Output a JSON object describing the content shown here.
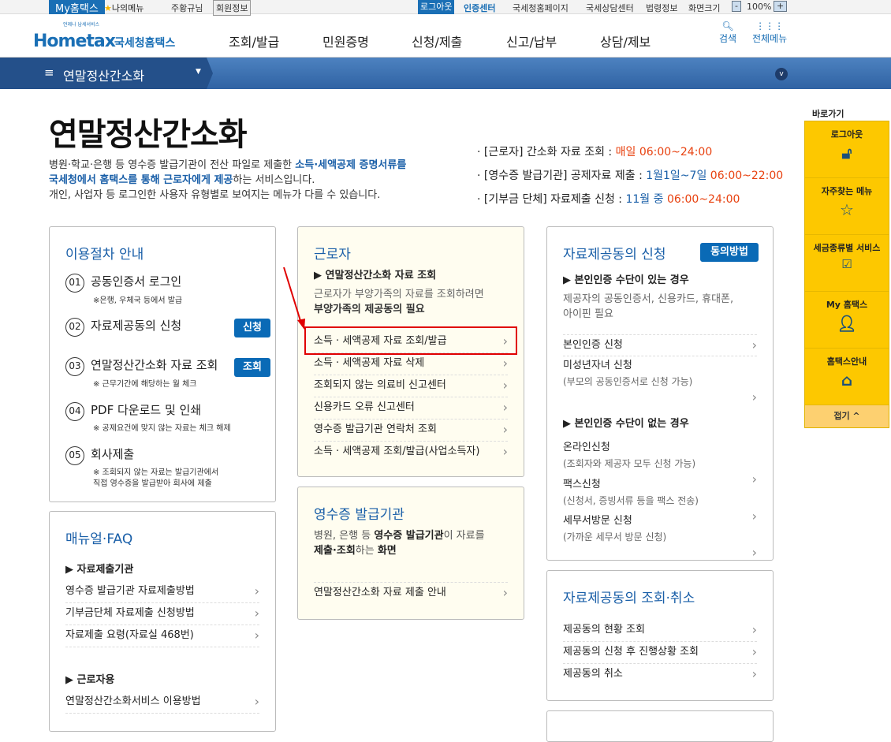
{
  "topbar": {
    "my_hometax": "My홈택스",
    "my_menu": "나의메뉴",
    "user": "주황규님",
    "member_info": "회원정보",
    "logout": "로그아웃",
    "cert_center": "인증센터",
    "links": [
      "국세청홈페이지",
      "국세상담센터",
      "법령정보",
      "화면크기"
    ],
    "zoom": "100%",
    "zoom_minus": "-",
    "zoom_plus": "+"
  },
  "header": {
    "logo": "Hometax",
    "logo_sub": "국세청홈택스",
    "logo_tag": "언제나 납세서비스",
    "nav": [
      "조회/발급",
      "민원증명",
      "신청/제출",
      "신고/납부",
      "상담/제보"
    ],
    "search": "검색",
    "all_menu": "전체메뉴"
  },
  "navbar": {
    "current": "연말정산간소화"
  },
  "page": {
    "title": "연말정산간소화",
    "intro1a": "병원·학교·은행 등 영수증 발급기관이 전산 파일로 제출한 ",
    "intro1b": "소득·세액공제 증명서류를",
    "intro2a": "국세청에서 홈택스를 통해 근로자에게 제공",
    "intro2b": "하는 서비스입니다.",
    "intro3": "개인, 사업자 등 로그인한 사용자 유형별로 보여지는 메뉴가 다를 수 있습니다.",
    "schedule": [
      {
        "label": "· [근로자] 간소화 자료 조회 : ",
        "period": "매일 ",
        "time": "06:00~24:00"
      },
      {
        "label": "· [영수증 발급기관] 공제자료 제출 : ",
        "period": "1월1일~7일 ",
        "time": "06:00~22:00"
      },
      {
        "label": "· [기부금 단체] 자료제출 신청 : ",
        "period": "11월 중 ",
        "time": "06:00~24:00"
      }
    ]
  },
  "procedure": {
    "title": "이용절차 안내",
    "steps": [
      {
        "num": "01",
        "label": "공동인증서 로그인",
        "note": "※은행, 우체국 등에서 발급"
      },
      {
        "num": "02",
        "label": "자료제공동의 신청",
        "button": "신청"
      },
      {
        "num": "03",
        "label": "연말정산간소화 자료 조회",
        "note": "※ 근무기간에 해당하는 월 체크",
        "button": "조회"
      },
      {
        "num": "04",
        "label": "PDF 다운로드 및 인쇄",
        "note": "※ 공제요건에 맞지 않는 자료는 체크 해제"
      },
      {
        "num": "05",
        "label": "회사제출",
        "note": "※ 조회되지 않는 자료는 발급기관에서",
        "note2": "직접 영수증을 발급받아 회사에 제출"
      }
    ]
  },
  "manual": {
    "title": "매뉴얼·FAQ",
    "sec1": "▶ 자료제출기관",
    "links1": [
      "영수증 발급기관 자료제출방법",
      "기부금단체 자료제출 신청방법",
      "자료제출 요령(자료실 468번)"
    ],
    "sec2": "▶ 근로자용",
    "links2": [
      "연말정산간소화서비스 이용방법"
    ]
  },
  "worker": {
    "title": "근로자",
    "sec": "▶ 연말정산간소화 자료 조회",
    "desc1": "근로자가 부양가족의 자료를 조회하려면",
    "desc2": "부양가족의 제공동의 필요",
    "links": [
      "소득 · 세액공제 자료 조회/발급",
      "소득 · 세액공제 자료 삭제",
      "조회되지 않는 의료비 신고센터",
      "신용카드 오류 신고센터",
      "영수증 발급기관 연락처 조회",
      "소득 · 세액공제 조회/발급(사업소득자)"
    ]
  },
  "issuer": {
    "title": "영수증 발급기관",
    "desc1a": "병원, 은행 등 ",
    "desc1b": "영수증 발급기관",
    "desc1c": "이 자료를",
    "desc2a": "제출·조회",
    "desc2b": "하는 ",
    "desc2c": "화면",
    "links": [
      "연말정산간소화 자료 제출 안내"
    ]
  },
  "consent": {
    "title": "자료제공동의 신청",
    "button": "동의방법",
    "sec1": "▶ 본인인증 수단이 있는 경우",
    "desc1": "제공자의 공동인증서, 신용카드, 휴대폰,",
    "desc2": "아이핀 필요",
    "links1": [
      {
        "label": "본인인증 신청"
      },
      {
        "label": "미성년자녀 신청",
        "sub": "(부모의 공동인증서로 신청 가능)"
      }
    ],
    "sec2": "▶ 본인인증 수단이 없는 경우",
    "links2": [
      {
        "label": "온라인신청",
        "sub": "(조회자와 제공자 모두 신청 가능)"
      },
      {
        "label": "팩스신청",
        "sub": "(신청서, 증빙서류 등을 팩스 전송)"
      },
      {
        "label": "세무서방문 신청",
        "sub": "(가까운 세무서 방문 신청)"
      }
    ]
  },
  "consent_query": {
    "title": "자료제공동의 조회·취소",
    "links": [
      "제공동의 현황 조회",
      "제공동의 신청 후 진행상황 조회",
      "제공동의 취소"
    ]
  },
  "quick": {
    "title": "바로가기",
    "items": [
      "로그아웃",
      "자주찾는 메뉴",
      "세금종류별 서비스",
      "My 홈택스",
      "홈택스안내"
    ],
    "fold": "접기 ^"
  },
  "colors": {
    "accent": "#1a5fa8",
    "highlight": "#e00000",
    "quick": "#fdc800"
  }
}
